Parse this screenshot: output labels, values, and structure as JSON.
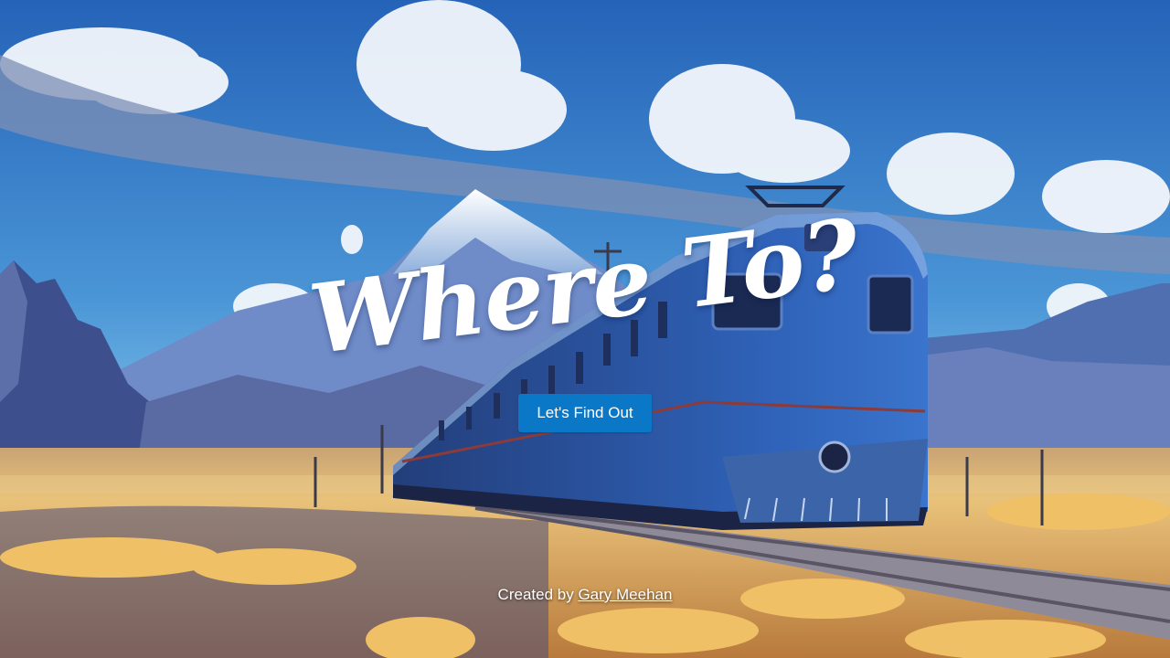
{
  "hero": {
    "title": "Where To?",
    "cta_label": "Let's Find Out"
  },
  "footer": {
    "credit_prefix": "Created by ",
    "author_name": "Gary Meehan"
  },
  "background": {
    "description_icon": "train-landscape-illustration",
    "colors": {
      "sky_top": "#2f74c4",
      "sky_bottom": "#7cc3ea",
      "grass": "#e8b865",
      "train": "#2d5fb0",
      "button": "#0b78c7"
    }
  }
}
